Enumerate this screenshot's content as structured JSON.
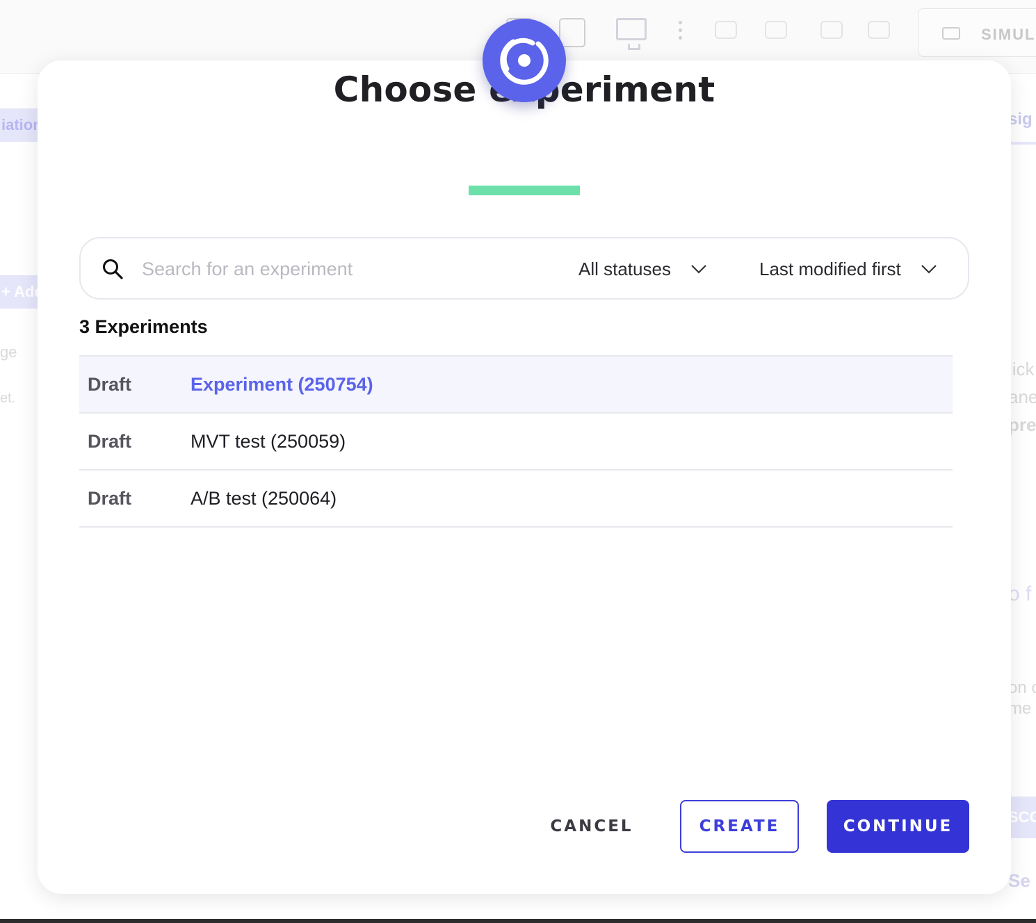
{
  "modal": {
    "title": "Choose experiment",
    "search": {
      "placeholder": "Search for an experiment",
      "value": ""
    },
    "status_filter": "All statuses",
    "sort_order": "Last modified first",
    "count_label": "3 Experiments",
    "experiments": [
      {
        "status": "Draft",
        "name": "Experiment (250754)",
        "selected": true
      },
      {
        "status": "Draft",
        "name": "MVT test (250059)",
        "selected": false
      },
      {
        "status": "Draft",
        "name": "A/B test (250064)",
        "selected": false
      }
    ],
    "buttons": {
      "cancel": "CANCEL",
      "create": "CREATE",
      "continue": "CONTINUE"
    }
  },
  "background": {
    "simulate_label": "SIMUL",
    "left_chip_1": "iation",
    "left_chip_2": "+ Add",
    "left_text_1": "ge",
    "left_text_2": "et.",
    "right_tab": "sig",
    "right_text_1": "lick",
    "right_text_2": "ane",
    "right_text_3": "prev",
    "right_text_4": "o f",
    "right_text_5": "on c",
    "right_text_6": "me",
    "right_button": "SCO",
    "right_text_7": "Se"
  },
  "colors": {
    "accent": "#5b63ea",
    "primary_button": "#3434d6",
    "title_underline": "#6de0aa",
    "selected_row": "#f4f5fd"
  }
}
